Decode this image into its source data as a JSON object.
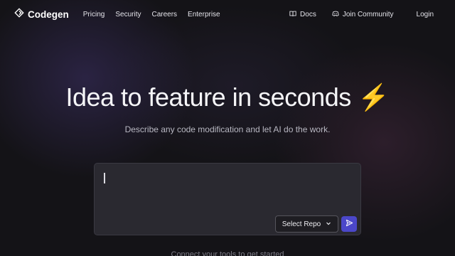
{
  "brand": {
    "name": "Codegen",
    "logo_icon": "codegen-logo-icon"
  },
  "nav": {
    "links": [
      "Pricing",
      "Security",
      "Careers",
      "Enterprise"
    ],
    "docs": {
      "label": "Docs",
      "icon": "book-icon"
    },
    "community": {
      "label": "Join Community",
      "icon": "discord-icon"
    },
    "login": "Login"
  },
  "hero": {
    "title": "Idea to feature in seconds",
    "emoji": "⚡",
    "subtitle": "Describe any code modification and let AI do the work."
  },
  "prompt": {
    "value": "",
    "placeholder": "",
    "repo_select_label": "Select Repo",
    "send_icon": "send-icon"
  },
  "footer": {
    "connect_text": "Connect your tools to get started"
  },
  "colors": {
    "accent": "#4b47c9",
    "background": "#141317",
    "bolt": "#f6c744"
  }
}
